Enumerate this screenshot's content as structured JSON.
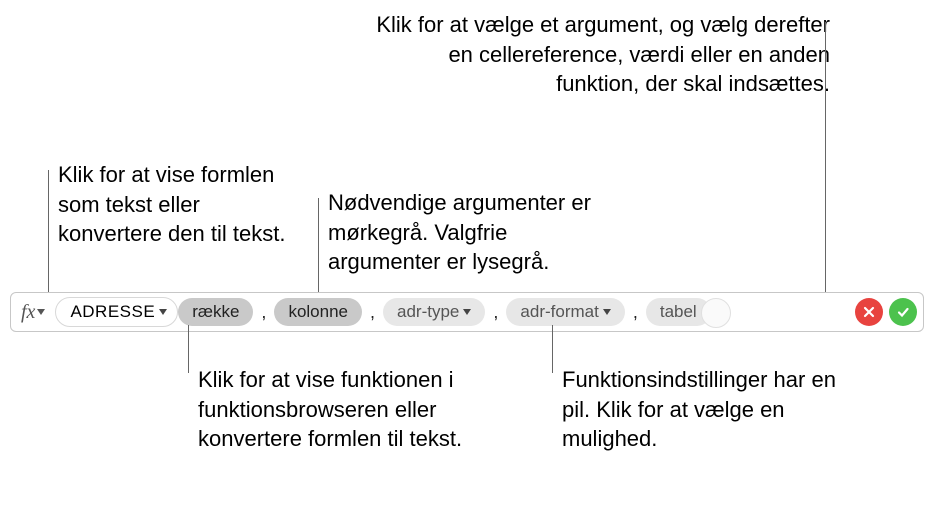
{
  "callouts": {
    "top_right": "Klik for at vælge et argument, og vælg derefter en cellereference, værdi eller en anden funktion, der skal indsættes.",
    "left": "Klik for at vise formlen som tekst eller konvertere den til tekst.",
    "center": "Nødvendige argumenter er mørkegrå. Valgfrie argumenter er lysegrå.",
    "bottom_left": "Klik for at vise funktionen i funktionsbrowseren eller konvertere formlen til tekst.",
    "bottom_right": "Funktionsindstillinger har en pil. Klik for at vælge en mulighed."
  },
  "formula_bar": {
    "fx_label": "fx",
    "function_name": "ADRESSE",
    "args": [
      {
        "label": "række",
        "kind": "required",
        "arrow": false
      },
      {
        "label": "kolonne",
        "kind": "required",
        "arrow": false
      },
      {
        "label": "adr-type",
        "kind": "optional",
        "arrow": true
      },
      {
        "label": "adr-format",
        "kind": "optional",
        "arrow": true
      },
      {
        "label": "tabel",
        "kind": "optional",
        "arrow": false
      }
    ],
    "separator": ","
  }
}
